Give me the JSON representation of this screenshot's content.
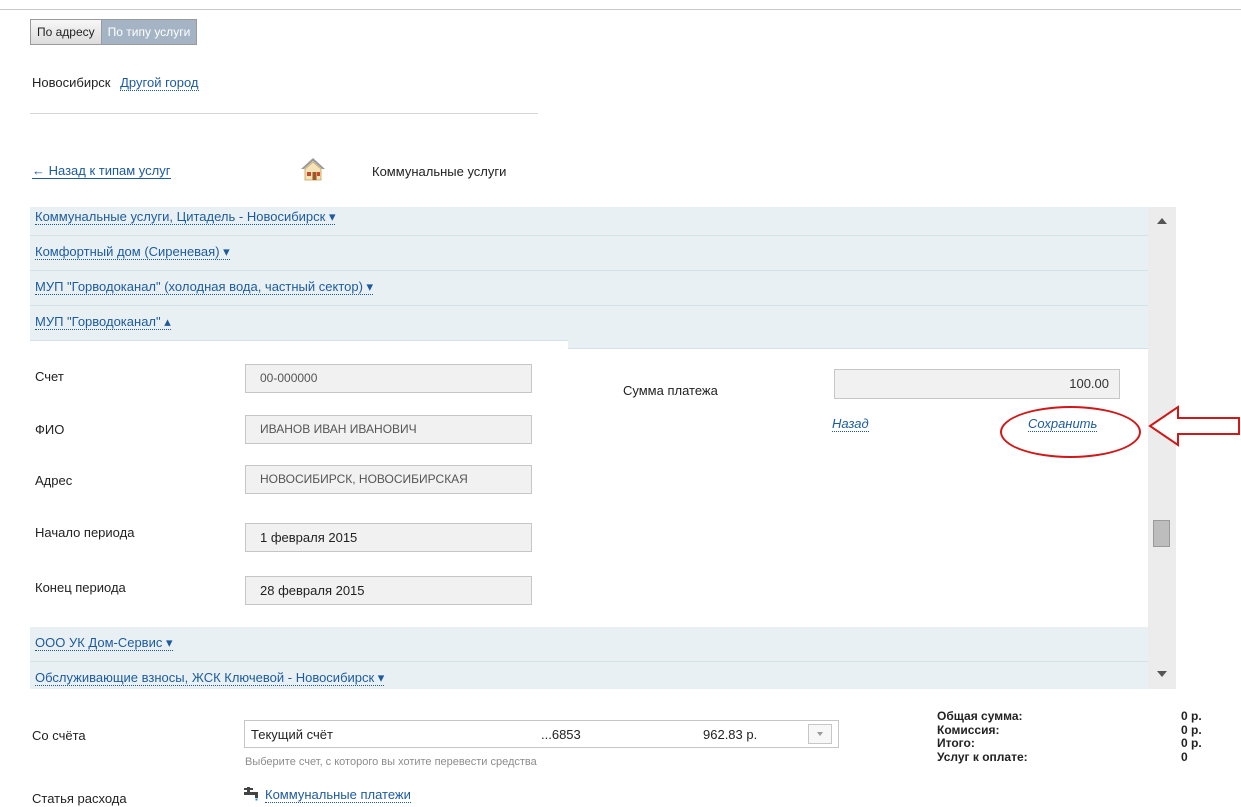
{
  "tabs": {
    "by_address": "По адресу",
    "by_service_type": "По типу услуги"
  },
  "city": {
    "current": "Новосибирск",
    "other_link": "Другой город"
  },
  "nav": {
    "back_link": "← Назад к типам услуг",
    "category_icon": "house-icon",
    "category_title": "Коммунальные услуги"
  },
  "providers": [
    {
      "label": "Коммунальные услуги, Цитадель - Новосибирск ▾"
    },
    {
      "label": "Комфортный дом (Сиреневая) ▾"
    },
    {
      "label": "МУП \"Горводоканал\" (холодная вода, частный сектор) ▾"
    },
    {
      "label": "МУП \"Горводоканал\" ▴"
    },
    {
      "label": "ООО УК Дом-Сервис ▾"
    },
    {
      "label": "Обслуживающие взносы, ЖСК Ключевой - Новосибирск ▾"
    }
  ],
  "form": {
    "account": {
      "label": "Счет",
      "value": "00-000000"
    },
    "name": {
      "label": "ФИО",
      "value": "ИВАНОВ ИВАН ИВАНОВИЧ"
    },
    "address": {
      "label": "Адрес",
      "value": "НОВОСИБИРСК, НОВОСИБИРСКАЯ"
    },
    "period_start": {
      "label": "Начало периода",
      "value": "1 февраля 2015"
    },
    "period_end": {
      "label": "Конец периода",
      "value": "28 февраля 2015"
    },
    "amount": {
      "label": "Сумма платежа",
      "value": "100.00"
    },
    "back_action": "Назад",
    "save_action": "Сохранить"
  },
  "payment": {
    "from_label": "Со счёта",
    "account_name": "Текущий счёт",
    "account_number": "...6853",
    "account_balance": "962.83 р.",
    "account_hint": "Выберите счет, с которого вы хотите перевести средства",
    "expense_label": "Статья расхода",
    "expense_value": "Коммунальные платежи"
  },
  "summary": {
    "total_label": "Общая сумма:",
    "total_value": "0 р.",
    "commission_label": "Комиссия:",
    "commission_value": "0 р.",
    "result_label": "Итого:",
    "result_value": "0 р.",
    "services_label": "Услуг к оплате:",
    "services_value": "0"
  },
  "colors": {
    "link": "#1d5b9d",
    "row_bg": "#e8f0f4",
    "annotation": "#d01818"
  }
}
